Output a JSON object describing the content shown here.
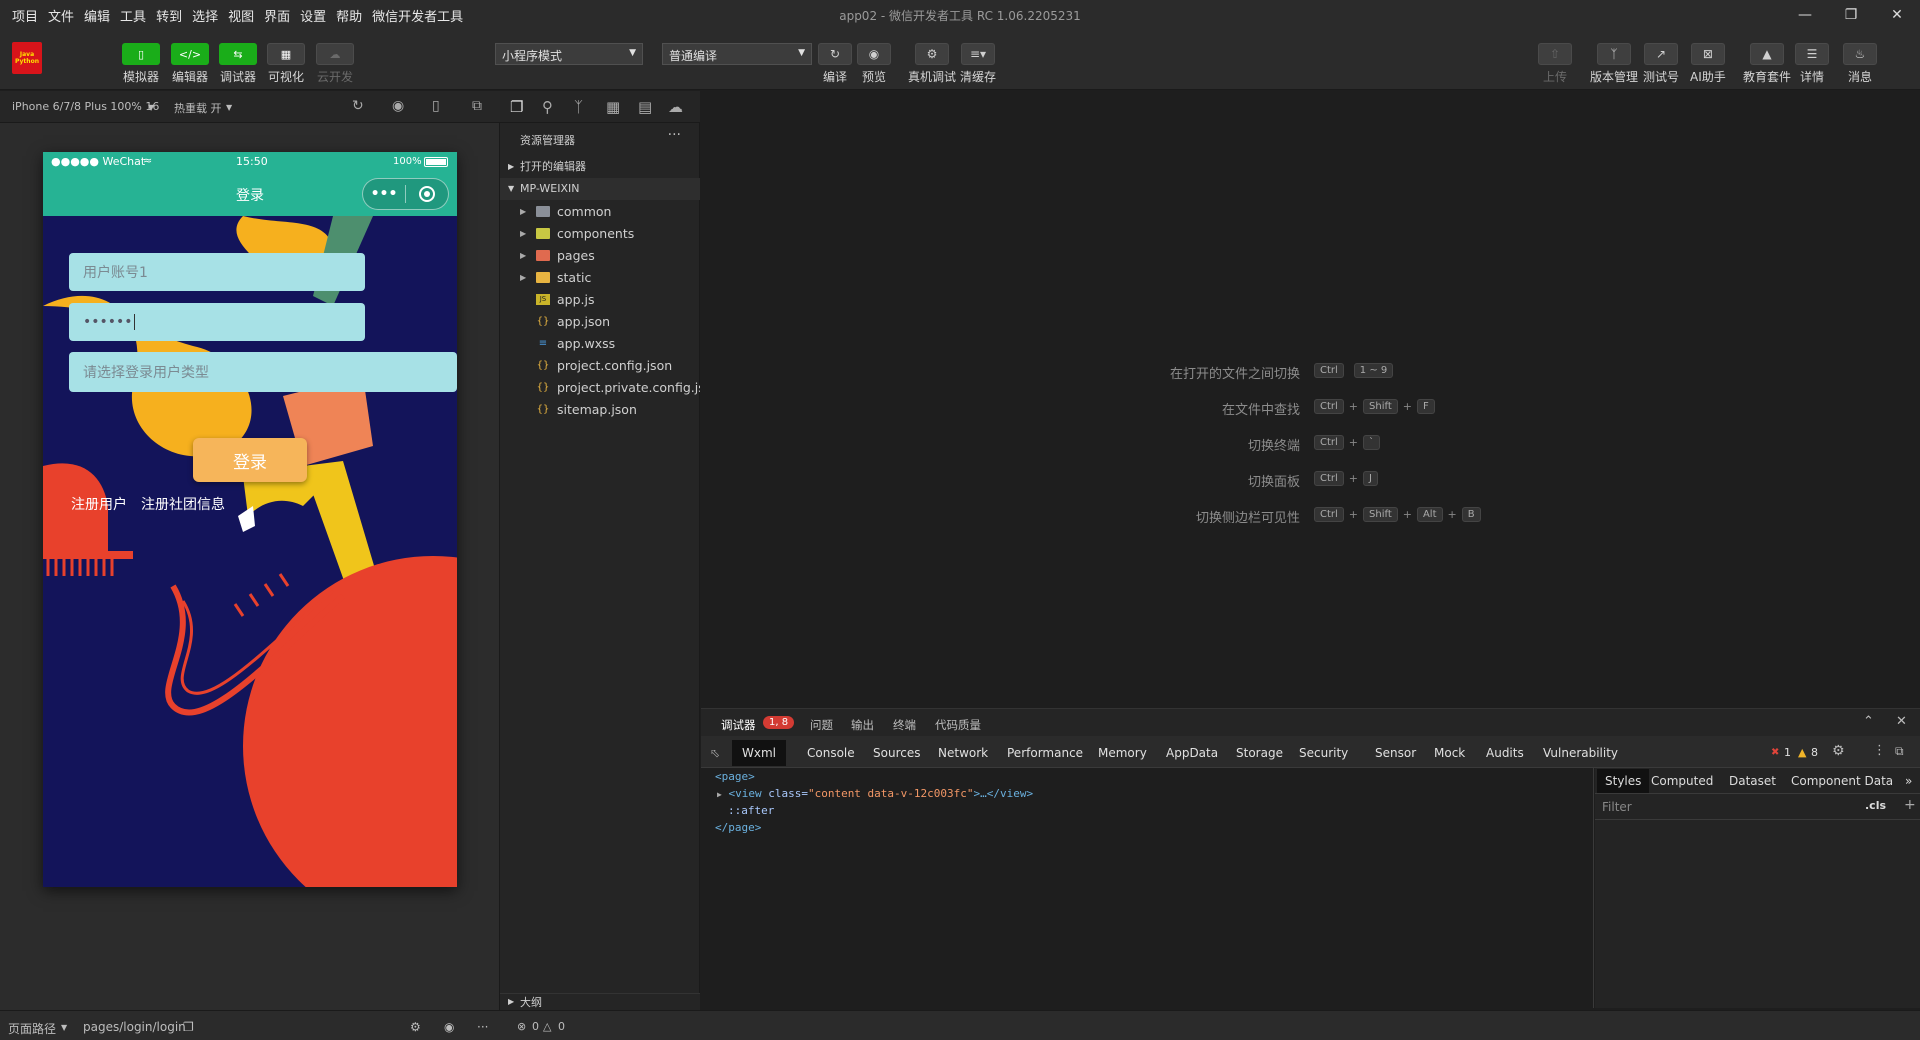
{
  "app": {
    "title": "app02 - 微信开发者工具 RC 1.06.2205231"
  },
  "menu": [
    "项目",
    "文件",
    "编辑",
    "工具",
    "转到",
    "选择",
    "视图",
    "界面",
    "设置",
    "帮助",
    "微信开发者工具"
  ],
  "logo": {
    "line1": "Java",
    "line2": "Python"
  },
  "toolbar": {
    "left_buttons": [
      "模拟器",
      "编辑器",
      "调试器",
      "可视化",
      "云开发"
    ],
    "mode_select": "小程序模式",
    "compile_select": "普通编译",
    "mid_buttons": [
      "编译",
      "预览",
      "真机调试",
      "清缓存"
    ],
    "right_buttons": [
      "上传",
      "版本管理",
      "测试号",
      "AI助手",
      "教育套件",
      "详情",
      "消息"
    ]
  },
  "simulator": {
    "device": "iPhone 6/7/8 Plus 100% 16",
    "hot_reload": "热重载 开"
  },
  "phone": {
    "carrier": "●●●●● WeChat",
    "time": "15:50",
    "battery": "100%",
    "nav_title": "登录",
    "capsule_dots": "•••",
    "account_placeholder": "用户账号1",
    "password_value": "••••••",
    "usertype_placeholder": "请选择登录用户类型",
    "login_button": "登录",
    "register_user": "注册用户",
    "register_club": "注册社团信息"
  },
  "explorer": {
    "title": "资源管理器",
    "more": "···",
    "open_editors": "打开的编辑器",
    "project": "MP-WEIXIN",
    "items": [
      {
        "name": "common",
        "type": "folder"
      },
      {
        "name": "components",
        "type": "folder"
      },
      {
        "name": "pages",
        "type": "folder"
      },
      {
        "name": "static",
        "type": "folder"
      },
      {
        "name": "app.js",
        "type": "js"
      },
      {
        "name": "app.json",
        "type": "json"
      },
      {
        "name": "app.wxss",
        "type": "wxss"
      },
      {
        "name": "project.config.json",
        "type": "json"
      },
      {
        "name": "project.private.config.js...",
        "type": "json"
      },
      {
        "name": "sitemap.json",
        "type": "json"
      }
    ],
    "outline": "大纲"
  },
  "shortcuts": [
    {
      "label": "在打开的文件之间切换",
      "keys": [
        "Ctrl",
        "1 ~ 9"
      ],
      "sep": ""
    },
    {
      "label": "在文件中查找",
      "keys": [
        "Ctrl",
        "Shift",
        "F"
      ],
      "sep": "+"
    },
    {
      "label": "切换终端",
      "keys": [
        "Ctrl",
        "`"
      ],
      "sep": "+"
    },
    {
      "label": "切换面板",
      "keys": [
        "Ctrl",
        "J"
      ],
      "sep": "+"
    },
    {
      "label": "切换侧边栏可见性",
      "keys": [
        "Ctrl",
        "Shift",
        "Alt",
        "B"
      ],
      "sep": "+"
    }
  ],
  "devtools": {
    "tabs": [
      "调试器",
      "问题",
      "输出",
      "终端",
      "代码质量"
    ],
    "badge": "1, 8",
    "subtabs": [
      "Wxml",
      "Console",
      "Sources",
      "Network",
      "Performance",
      "Memory",
      "AppData",
      "Storage",
      "Security",
      "Sensor",
      "Mock",
      "Audits",
      "Vulnerability"
    ],
    "errors": "1",
    "warnings": "8",
    "wxml": {
      "line1": "<page>",
      "line2_tag": "<view ",
      "line2_attr": "class=",
      "line2_val": "\"content data-v-12c003fc\"",
      "line2_rest": ">…</view>",
      "line3": "::after",
      "line4": "</page>"
    },
    "style_tabs": [
      "Styles",
      "Computed",
      "Dataset",
      "Component Data"
    ],
    "filter_placeholder": "Filter",
    "cls": ".cls"
  },
  "statusbar": {
    "page_path_label": "页面路径",
    "page_path": "pages/login/login",
    "errors_count": "0",
    "warnings_count": "0"
  },
  "colors": {
    "accent_green": "#1aad19",
    "wechat_nav": "#26b394",
    "phone_bg": "#13145a",
    "error_red": "#d33b33"
  }
}
